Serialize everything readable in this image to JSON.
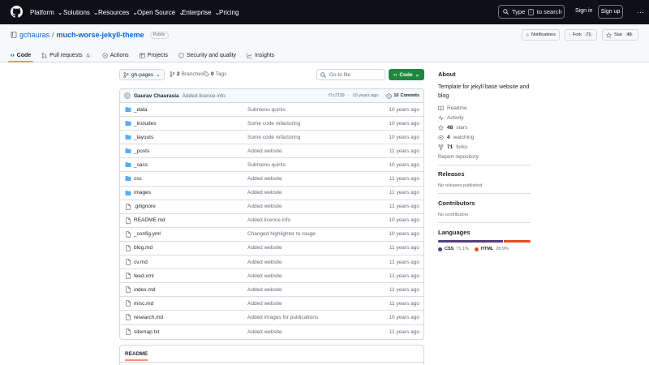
{
  "header": {
    "nav": [
      {
        "label": "Platform",
        "has_menu": true
      },
      {
        "label": "Solutions",
        "has_menu": true
      },
      {
        "label": "Resources",
        "has_menu": true
      },
      {
        "label": "Open Source",
        "has_menu": true
      },
      {
        "label": "Enterprise",
        "has_menu": true
      },
      {
        "label": "Pricing",
        "has_menu": false
      }
    ],
    "search": {
      "before": "Type",
      "key": "/",
      "after": "to search"
    },
    "sign_in": "Sign in",
    "sign_up": "Sign up"
  },
  "repo": {
    "owner": "gchauras",
    "separator": "/",
    "name": "much-worse-jekyll-theme",
    "visibility": "Public",
    "notifications": "Notifications",
    "fork_label": "Fork",
    "fork_count": "71",
    "star_label": "Star",
    "star_count": "48"
  },
  "tabs": [
    {
      "label": "Code",
      "icon": "code-icon",
      "active": true
    },
    {
      "label": "Pull requests",
      "icon": "pull-request-icon",
      "counter": "1"
    },
    {
      "label": "Actions",
      "icon": "play-icon"
    },
    {
      "label": "Projects",
      "icon": "table-icon"
    },
    {
      "label": "Security and quality",
      "icon": "shield-icon"
    },
    {
      "label": "Insights",
      "icon": "graph-icon"
    }
  ],
  "toolbar": {
    "branch": "gh-pages",
    "branches_count": "2",
    "branches_label": "Branches",
    "tags_count": "0",
    "tags_label": "Tags",
    "goto_placeholder": "Go to file",
    "code_button": "Code"
  },
  "latest_commit": {
    "author": "Gaurav Chaurasia",
    "message": "Added licence info",
    "hash": "f7c7239",
    "age": "10 years ago",
    "commits_count": "10",
    "commits_label": "Commits"
  },
  "files": [
    {
      "name": "_data",
      "type": "folder",
      "message": "Submenu quirks",
      "age": "10 years ago"
    },
    {
      "name": "_includes",
      "type": "folder",
      "message": "Some code refactoring",
      "age": "10 years ago"
    },
    {
      "name": "_layouts",
      "type": "folder",
      "message": "Some code refactoring",
      "age": "10 years ago"
    },
    {
      "name": "_posts",
      "type": "folder",
      "message": "Added website",
      "age": "11 years ago"
    },
    {
      "name": "_sass",
      "type": "folder",
      "message": "Submenu quirks",
      "age": "10 years ago"
    },
    {
      "name": "css",
      "type": "folder",
      "message": "Added website",
      "age": "11 years ago"
    },
    {
      "name": "images",
      "type": "folder",
      "message": "Added website",
      "age": "11 years ago"
    },
    {
      "name": ".gitignore",
      "type": "file",
      "message": "Added website",
      "age": "11 years ago"
    },
    {
      "name": "README.md",
      "type": "file",
      "message": "Added licence info",
      "age": "10 years ago"
    },
    {
      "name": "_config.yml",
      "type": "file",
      "message": "Changed highlighter to rouge",
      "age": "10 years ago"
    },
    {
      "name": "blog.md",
      "type": "file",
      "message": "Added website",
      "age": "11 years ago"
    },
    {
      "name": "cv.md",
      "type": "file",
      "message": "Added website",
      "age": "11 years ago"
    },
    {
      "name": "feed.xml",
      "type": "file",
      "message": "Added website",
      "age": "11 years ago"
    },
    {
      "name": "index.md",
      "type": "file",
      "message": "Added website",
      "age": "11 years ago"
    },
    {
      "name": "misc.md",
      "type": "file",
      "message": "Added website",
      "age": "11 years ago"
    },
    {
      "name": "research.md",
      "type": "file",
      "message": "Added images for publications",
      "age": "10 years ago"
    },
    {
      "name": "sitemap.txt",
      "type": "file",
      "message": "Added website",
      "age": "11 years ago"
    }
  ],
  "readme": {
    "tab": "README"
  },
  "about": {
    "title": "About",
    "description": "Template for jekyll base website and blog",
    "links": [
      {
        "icon": "book-icon",
        "label": "Readme"
      },
      {
        "icon": "pulse-icon",
        "label": "Activity"
      },
      {
        "icon": "star-icon",
        "count": "48",
        "label": "stars"
      },
      {
        "icon": "eye-icon",
        "count": "4",
        "label": "watching"
      },
      {
        "icon": "fork-icon",
        "count": "71",
        "label": "forks"
      }
    ],
    "report": "Report repository"
  },
  "releases": {
    "title": "Releases",
    "empty": "No releases published"
  },
  "contributors": {
    "title": "Contributors",
    "empty": "No contributors"
  },
  "languages": {
    "title": "Languages",
    "items": [
      {
        "name": "CSS",
        "percent": "71.1%",
        "value": 71.1,
        "color": "#563d7c"
      },
      {
        "name": "HTML",
        "percent": "28.9%",
        "value": 28.9,
        "color": "#e34c26"
      }
    ]
  },
  "colors": {
    "header_bg": "#0d1117",
    "accent_tab": "#fd8c73",
    "folder": "#54aeff",
    "code_button": "#1f883d",
    "link": "#0969da"
  }
}
